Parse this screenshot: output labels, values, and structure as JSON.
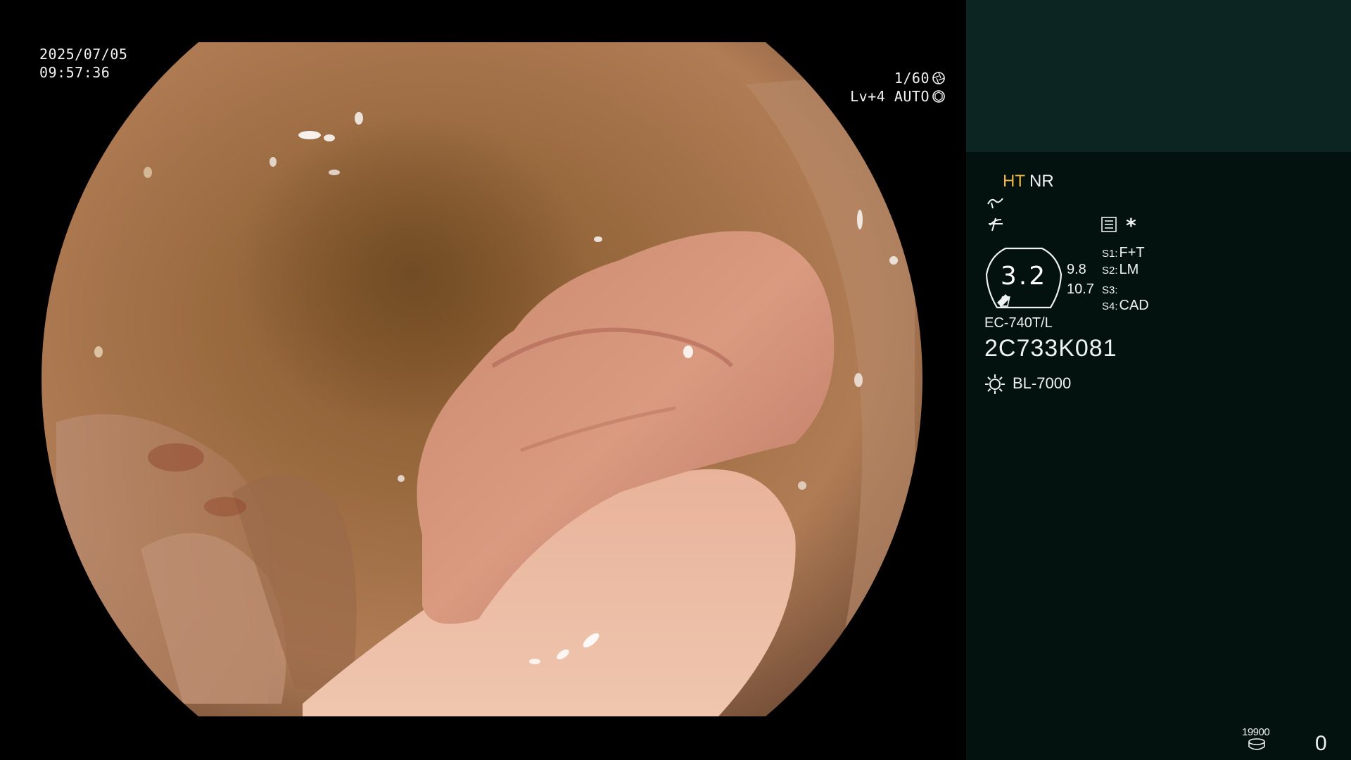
{
  "overlay": {
    "date": "2025/07/05",
    "time": "09:57:36",
    "shutter": "1/60",
    "shutter_icon": "shutter-icon",
    "level": "Lv+4 AUTO",
    "auto_icon": "iris-icon"
  },
  "panel": {
    "mode_primary": "HT",
    "mode_secondary": "NR",
    "enhance_icon": "enhance-icon",
    "color_icon": "color-icon",
    "menu_icon": "menu-icon",
    "star": "*",
    "zoom_value": "3.2",
    "zoom_sub_1": "9.8",
    "zoom_sub_2": "10.7",
    "switches": [
      {
        "key": "S1:",
        "value": "F+T"
      },
      {
        "key": "S2:",
        "value": "LM"
      },
      {
        "key": "S3:",
        "value": ""
      },
      {
        "key": "S4:",
        "value": "CAD"
      }
    ],
    "scope_model": "EC-740T/L",
    "scope_serial": "2C733K081",
    "light_icon": "light-source-icon",
    "light_source": "BL-7000",
    "counter_label": "19900",
    "counter_icon": "disk-icon",
    "counter_value": "0"
  },
  "colors": {
    "panel_bg": "#04120f",
    "panel_top_bg": "#0c2522",
    "accent_ht": "#f0b542"
  }
}
